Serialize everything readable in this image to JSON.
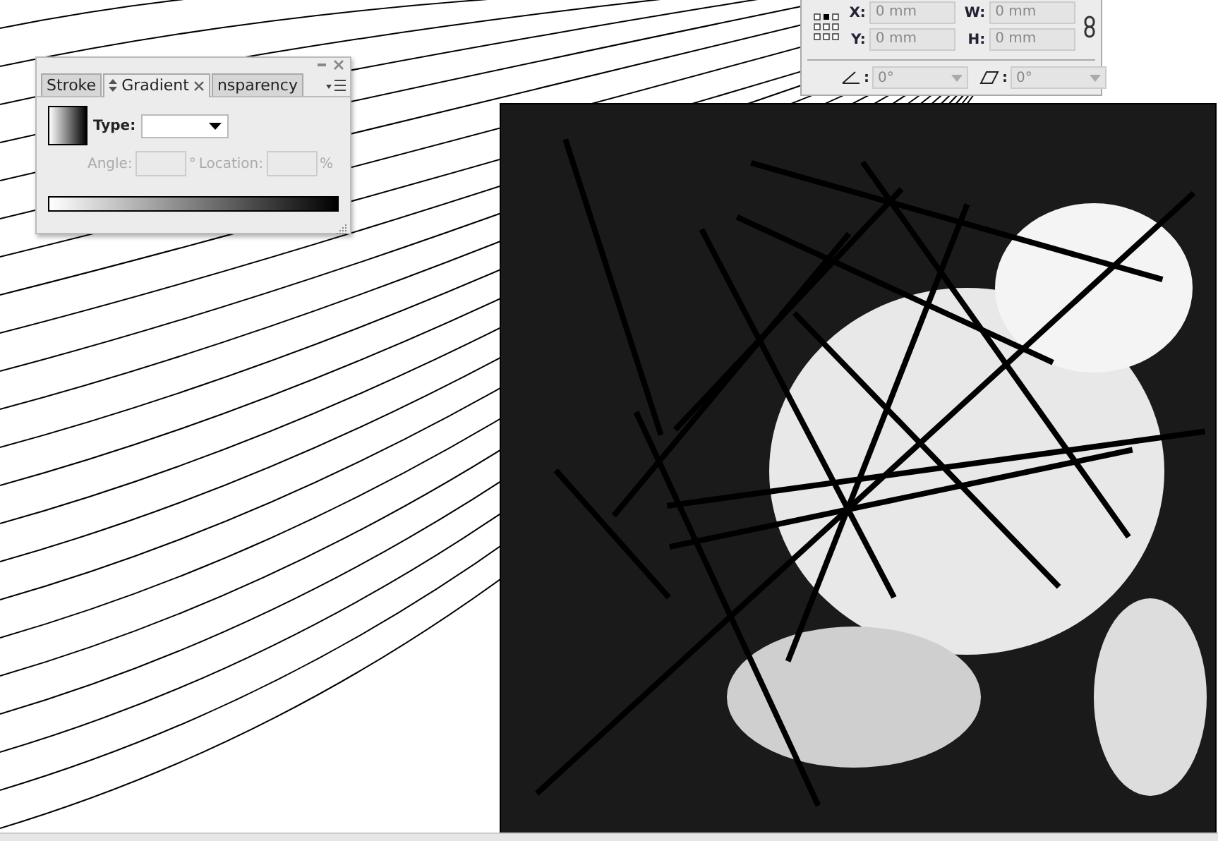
{
  "gradient_panel": {
    "tabs": [
      {
        "label": "Stroke",
        "selected": false
      },
      {
        "label": "Gradient",
        "selected": true
      },
      {
        "label": "nsparency",
        "selected": false
      }
    ],
    "type_label": "Type:",
    "angle_label": "Angle:",
    "angle_unit": "°",
    "location_label": "Location:",
    "location_unit": "%"
  },
  "transform_panel": {
    "fields": [
      {
        "label": "X:",
        "value": "0 mm"
      },
      {
        "label": "W:",
        "value": "0 mm"
      },
      {
        "label": "Y:",
        "value": "0 mm"
      },
      {
        "label": "H:",
        "value": "0 mm"
      }
    ],
    "angles": [
      {
        "kind": "rotate",
        "separator": ":",
        "value": "0°"
      },
      {
        "kind": "shear",
        "separator": ":",
        "value": "0°"
      }
    ]
  }
}
